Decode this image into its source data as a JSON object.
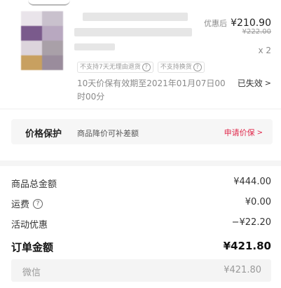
{
  "product": {
    "price_after_label": "优惠后",
    "price_after": "¥210.90",
    "price_original": "¥222.00",
    "quantity": "x 2",
    "tags": [
      "不支持7天无理由退货",
      "不支持换货"
    ],
    "price_protect_note": "10天价保有效期至2021年01月07日00时00分",
    "expired_label": "已失效",
    "thumbnail_colors": [
      "#e9e4ea",
      "#c9c1cd",
      "#7a5a8c",
      "#b8a8c0",
      "#dcd4dc",
      "#a9a0a8",
      "#c8a060",
      "#9a8c9c"
    ]
  },
  "price_protection": {
    "title": "价格保护",
    "description": "商品降价可补差额",
    "link_label": "申请价保"
  },
  "summary": {
    "rows": [
      {
        "label": "商品总金额",
        "value": "¥444.00"
      },
      {
        "label": "运费",
        "value": "¥0.00"
      },
      {
        "label": "活动优惠",
        "value": "−¥22.20"
      }
    ],
    "total_label": "订单金额",
    "total_value": "¥421.80",
    "payment_method": "微信",
    "payment_value": "¥421.80"
  }
}
